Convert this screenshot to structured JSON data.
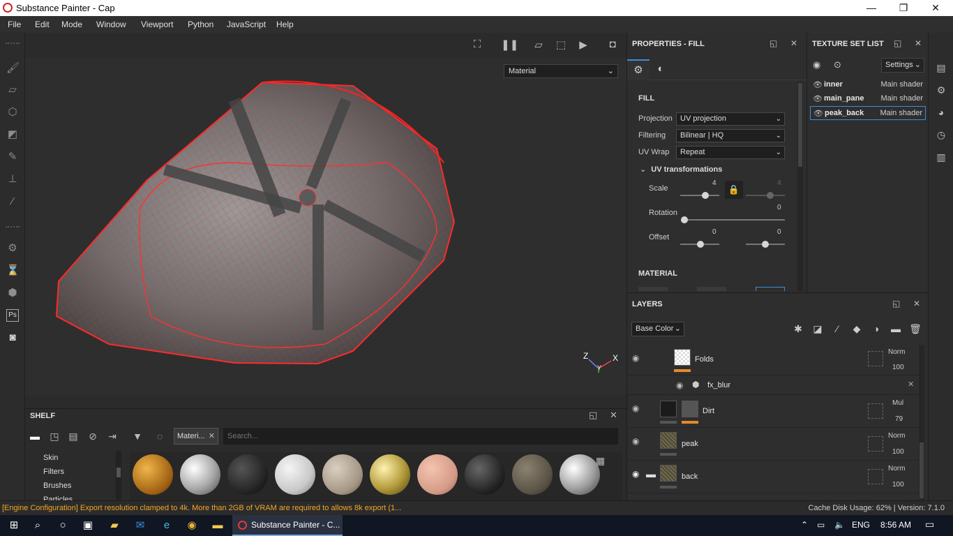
{
  "window": {
    "title": "Substance Painter - Cap",
    "minimize": "—",
    "maximize": "❐",
    "close": "✕"
  },
  "menu": [
    "File",
    "Edit",
    "Mode",
    "Window",
    "Viewport",
    "Python",
    "JavaScript",
    "Help"
  ],
  "viewport": {
    "material_select": "Material",
    "axis_labels": {
      "z": "Z",
      "y": "Y",
      "x": "X"
    }
  },
  "shelf": {
    "title": "SHELF",
    "filter_tag": "Materi...",
    "search_placeholder": "Search...",
    "categories": [
      "Skin",
      "Filters",
      "Brushes",
      "Particles"
    ]
  },
  "properties": {
    "title": "PROPERTIES - FILL",
    "section_fill": "FILL",
    "projection_label": "Projection",
    "projection_value": "UV projection",
    "filtering_label": "Filtering",
    "filtering_value": "Bilinear | HQ",
    "uvwrap_label": "UV Wrap",
    "uvwrap_value": "Repeat",
    "uv_transformations": "UV transformations",
    "scale_label": "Scale",
    "scale_value": "4",
    "scale_value_locked": "4",
    "rotation_label": "Rotation",
    "rotation_value": "0",
    "offset_label": "Offset",
    "offset_u": "0",
    "offset_v": "0",
    "section_material": "MATERIAL"
  },
  "texture_set_list": {
    "title": "TEXTURE SET LIST",
    "settings": "Settings",
    "items": [
      {
        "name": "inner",
        "shader": "Main shader"
      },
      {
        "name": "main_pane",
        "shader": "Main shader"
      },
      {
        "name": "peak_back",
        "shader": "Main shader"
      }
    ]
  },
  "layers": {
    "title": "LAYERS",
    "channel": "Base Color",
    "items": [
      {
        "name": "Folds",
        "blend": "Norm",
        "opacity": "100"
      },
      {
        "name": "fx_blur"
      },
      {
        "name": "Dirt",
        "blend": "Mul",
        "opacity": "79"
      },
      {
        "name": "peak",
        "blend": "Norm",
        "opacity": "100"
      },
      {
        "name": "back",
        "blend": "Norm",
        "opacity": "100"
      }
    ]
  },
  "status": {
    "message": "[Engine Configuration] Export resolution clamped to 4k. More than 2GB of VRAM are required to allows 8k export (1...",
    "cache": "Cache Disk Usage:  62% | Version: 7.1.0"
  },
  "taskbar": {
    "app_label": "Substance Painter - C...",
    "language": "ENG",
    "time": "8:56 AM"
  },
  "colors": {
    "accent": "#3b8edb",
    "warning": "#f5a623",
    "wireframe": "#ff2020",
    "layer_orange": "#e58a2c"
  }
}
